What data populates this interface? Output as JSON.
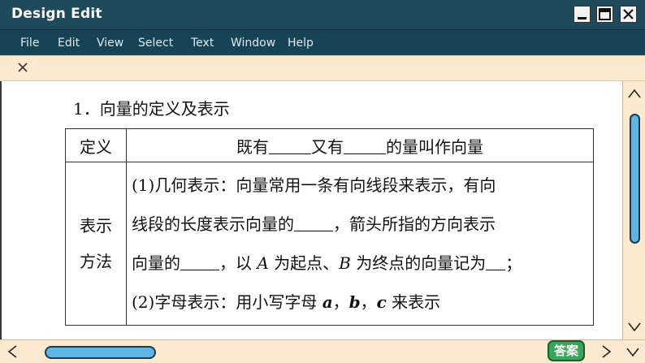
{
  "window": {
    "title": "Design Edit",
    "controls": {
      "minimize": "minimize-icon",
      "maximize": "maximize-icon",
      "close": "close-icon"
    }
  },
  "menu": [
    "File",
    "Edit",
    "View",
    "Select",
    "Text",
    "Window",
    "Help"
  ],
  "tabbar": {
    "close_icon": "close-icon"
  },
  "document": {
    "heading": "1．向量的定义及表示",
    "table": {
      "row1": {
        "label": "定义",
        "content": {
          "p1": "既有",
          "p2": "又有",
          "p3": "的量叫作向量"
        }
      },
      "row2": {
        "label_line1": "表示",
        "label_line2": "方法",
        "line1": "(1)几何表示：向量常用一条有向线段来表示，有向",
        "line2": {
          "p1": "线段的长度表示向量的",
          "p2": "，箭头所指的方向表示"
        },
        "line3": {
          "p1": "向量的",
          "p2": "，以 ",
          "var_a": "A",
          "p3": " 为起点、",
          "var_b": "B",
          "p4": " 为终点的向量记为",
          "p5": "；"
        },
        "line4": {
          "p1": "(2)字母表示：用小写字母 ",
          "a": "a",
          "sep1": "，",
          "b": "b",
          "sep2": "，",
          "c": "c",
          "p2": " 来表示"
        }
      }
    }
  },
  "answer_button": {
    "label": "答案"
  },
  "colors": {
    "titlebar": "#1f4a5c",
    "menubar": "#164456",
    "panel": "#fbe9d0",
    "scroll_thumb": "#5fb4e6",
    "answer_button": "#3aa55a"
  }
}
